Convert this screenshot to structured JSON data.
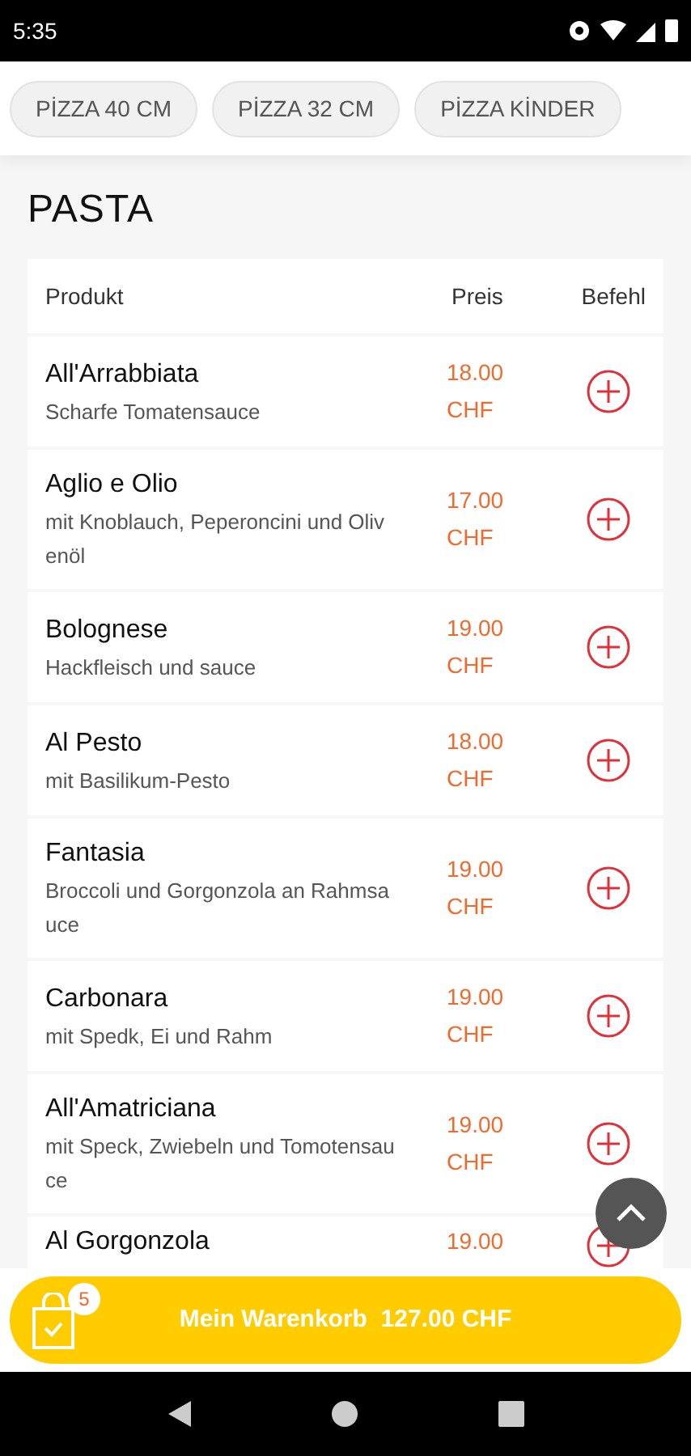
{
  "status_bar": {
    "time": "5:35"
  },
  "categories": [
    {
      "label": "PİZZA 40 CM",
      "selected": false
    },
    {
      "label": "PİZZA 32 CM",
      "selected": false
    },
    {
      "label": "PİZZA KİNDER",
      "selected": false
    }
  ],
  "section_title": "PASTA",
  "table": {
    "columns": [
      "Produkt",
      "Preis",
      "Befehl"
    ],
    "rows": [
      {
        "name": "All'Arrabbiata",
        "description": "Scharfe Tomatensauce",
        "price": "18.00 CHF"
      },
      {
        "name": "Aglio e Olio",
        "description": "mit Knoblauch, Peperoncini und Olivenöl",
        "price": "17.00 CHF"
      },
      {
        "name": "Bolognese",
        "description": "Hackfleisch und sauce",
        "price": "19.00 CHF"
      },
      {
        "name": "Al Pesto",
        "description": "mit Basilikum-Pesto",
        "price": "18.00 CHF"
      },
      {
        "name": "Fantasia",
        "description": "Broccoli und Gorgonzola an Rahmsauce",
        "price": "19.00 CHF"
      },
      {
        "name": "Carbonara",
        "description": "mit Spedk, Ei und Rahm",
        "price": "19.00 CHF"
      },
      {
        "name": "All'Amatriciana",
        "description": "mit Speck, Zwiebeln und Tomotensauce",
        "price": "19.00 CHF"
      },
      {
        "name": "Al Gorgonzola",
        "price": "19.00"
      }
    ]
  },
  "cart": {
    "count": "5",
    "label": "Mein Warenkorb  127.00 CHF"
  }
}
